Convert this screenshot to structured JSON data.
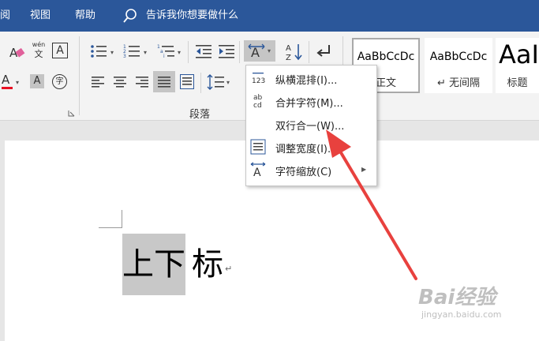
{
  "menubar": {
    "items": [
      "阅",
      "视图",
      "帮助"
    ],
    "tell_me": "告诉我你想要做什么"
  },
  "ribbon": {
    "phonetic_top": "wén",
    "phonetic_bottom": "文",
    "char_border": "A",
    "font_color_letter": "A",
    "shading_letter": "A",
    "enclose_char": "字",
    "paragraph_label": "段落",
    "styles": [
      {
        "sample": "AaBbCcDc",
        "name": "正文"
      },
      {
        "sample": "AaBbCcDc",
        "name": "↵ 无间隔"
      },
      {
        "sample": "AaI",
        "name": "标题"
      }
    ]
  },
  "context_menu": {
    "items": [
      {
        "icon": "123",
        "label": "纵横混排(I)..."
      },
      {
        "icon": "ab cd",
        "label": "合并字符(M)..."
      },
      {
        "icon": "",
        "label": "双行合一(W)..."
      },
      {
        "icon": "width-icon",
        "label": "调整宽度(I)..."
      },
      {
        "icon": "scale-icon",
        "label": "字符缩放(C)"
      }
    ]
  },
  "document": {
    "highlighted_text": "上下",
    "plain_text": "标",
    "para_mark": "↵"
  },
  "watermark": {
    "brand": "Bai经验",
    "url": "jingyan.baidu.com"
  },
  "colors": {
    "title_bar": "#2b579a",
    "font_color_underline": "#e81123",
    "arrow": "#e8413e",
    "highlight": "#c8c8c8"
  }
}
